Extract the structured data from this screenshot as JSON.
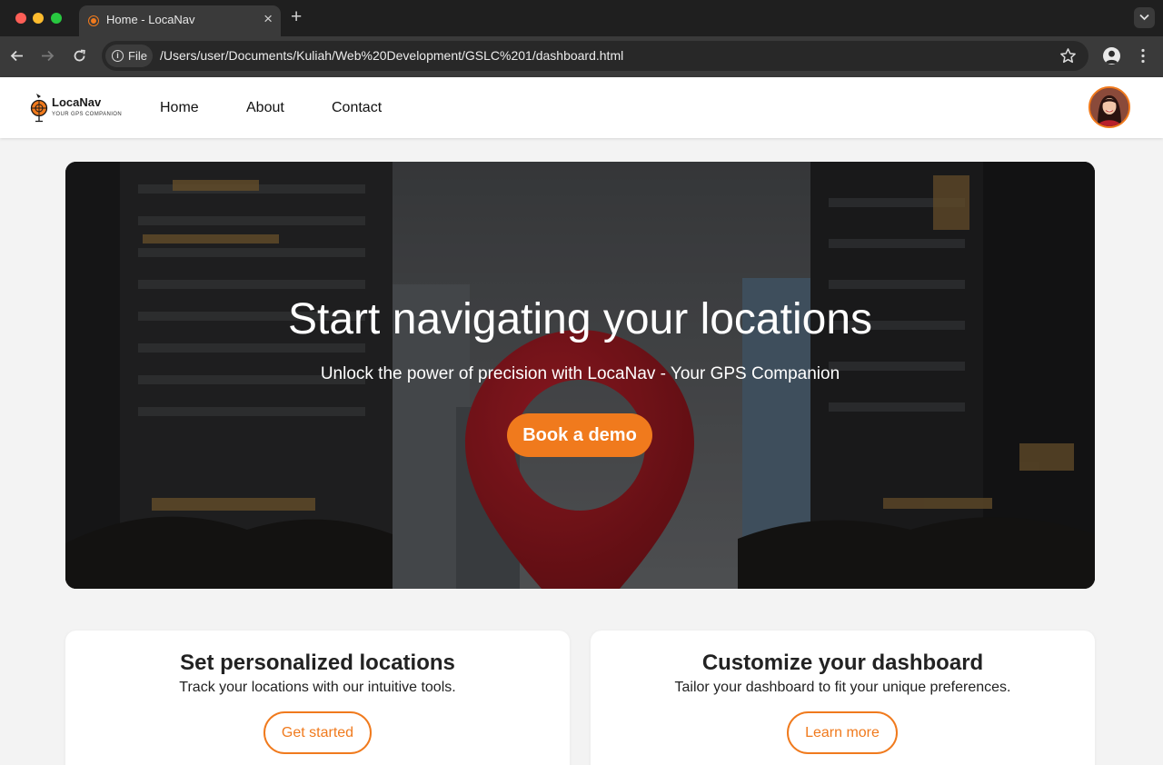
{
  "browser": {
    "tab_title": "Home - LocaNav",
    "new_tab_icon": "+",
    "close_icon": "×",
    "address_chip_label": "File",
    "url": "/Users/user/Documents/Kuliah/Web%20Development/GSLC%201/dashboard.html",
    "traffic_colors": [
      "#ff5f57",
      "#febc2e",
      "#28c840"
    ]
  },
  "site": {
    "logo": {
      "name": "LocaNav",
      "tagline": "YOUR GPS COMPANION"
    },
    "nav": [
      {
        "label": "Home"
      },
      {
        "label": "About"
      },
      {
        "label": "Contact"
      }
    ],
    "accent_color": "#f07a1d"
  },
  "hero": {
    "title": "Start navigating your locations",
    "subtitle": "Unlock the power of precision with LocaNav - Your GPS Companion",
    "button_label": "Book a demo"
  },
  "features": [
    {
      "title": "Set personalized locations",
      "text": "Track your locations with our intuitive tools.",
      "button_label": "Get started"
    },
    {
      "title": "Customize your dashboard",
      "text": "Tailor your dashboard to fit your unique preferences.",
      "button_label": "Learn more"
    }
  ]
}
